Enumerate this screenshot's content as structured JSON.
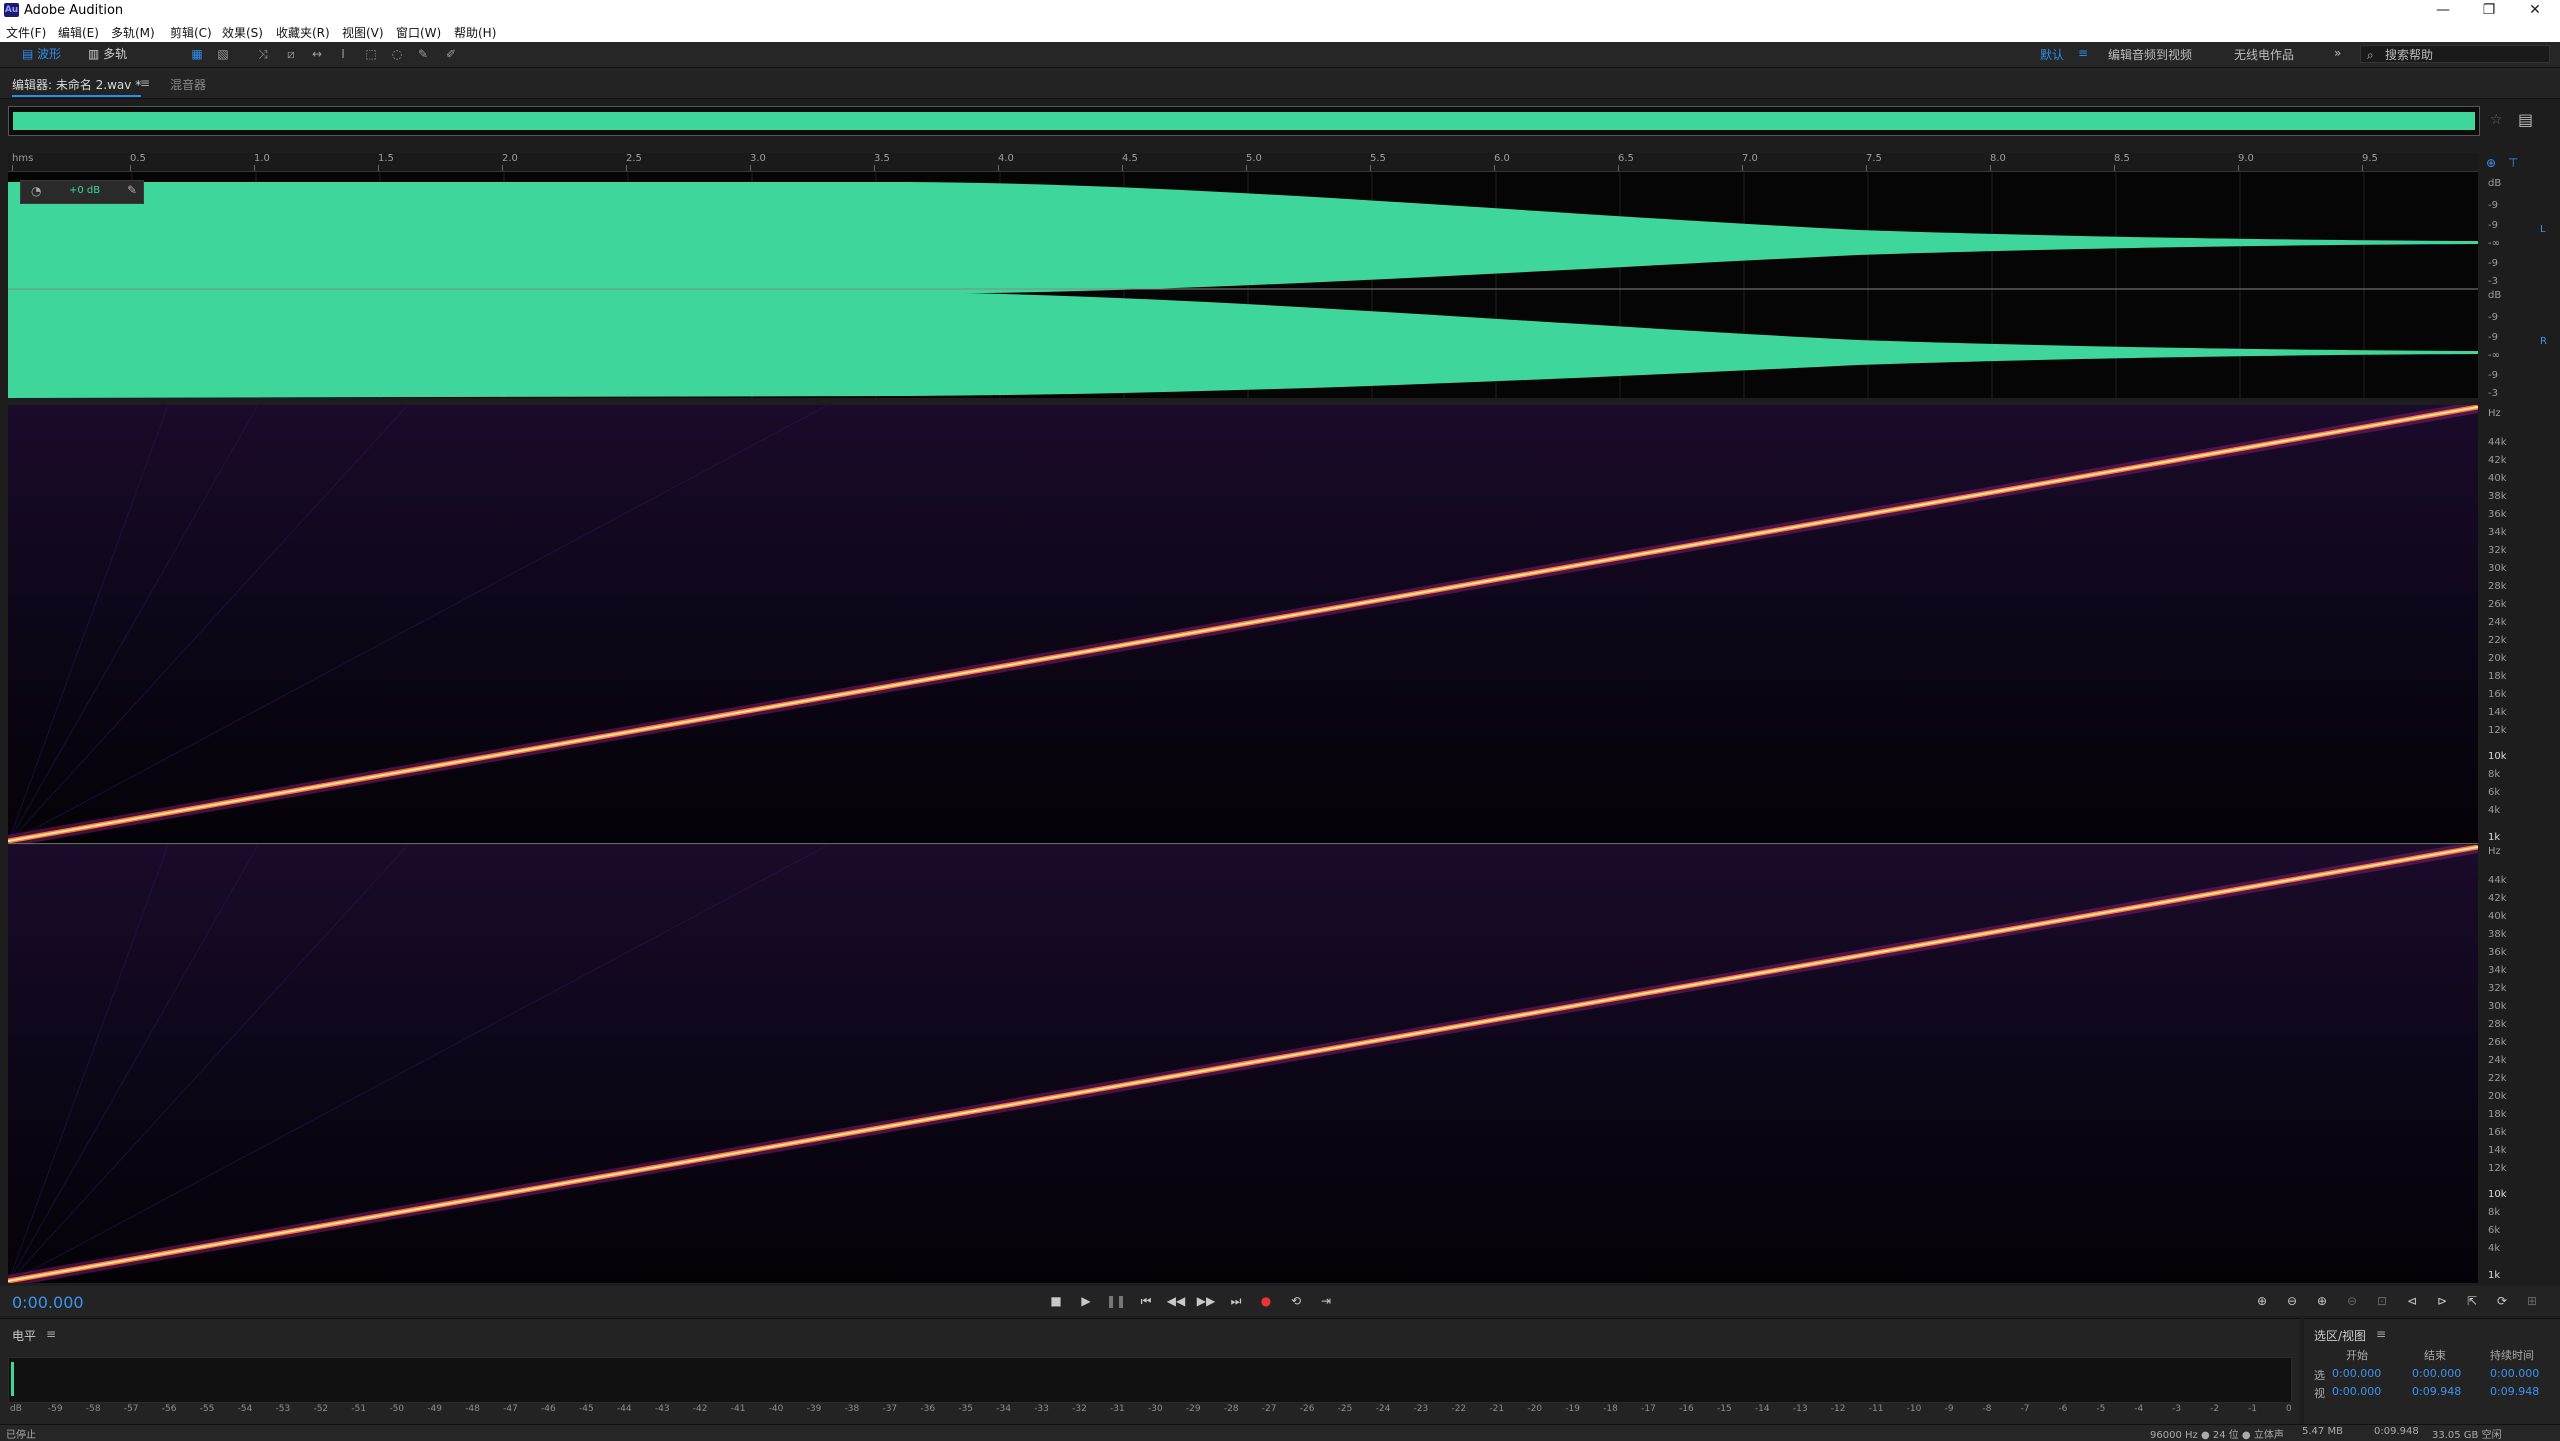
{
  "app": {
    "title": "Adobe Audition",
    "logo": "Au"
  },
  "window_controls": [
    "—",
    "❐",
    "✕"
  ],
  "menu": [
    "文件(F)",
    "编辑(E)",
    "多轨(M)",
    "剪辑(C)",
    "效果(S)",
    "收藏夹(R)",
    "视图(V)",
    "窗口(W)",
    "帮助(H)"
  ],
  "toolbar": {
    "waveform_label": "波形",
    "multitrack_label": "多轨",
    "workspace_active": "默认",
    "workspaces": [
      "编辑音频到视频",
      "无线电作品"
    ],
    "overflow": "»",
    "search_placeholder": "搜索帮助"
  },
  "tabs": {
    "editor": "编辑器: 未命名 2.wav *",
    "mixer": "混音器"
  },
  "ruler": {
    "unit": "hms",
    "ticks": [
      "0.5",
      "1.0",
      "1.5",
      "2.0",
      "2.5",
      "3.0",
      "3.5",
      "4.0",
      "4.5",
      "5.0",
      "5.5",
      "6.0",
      "6.5",
      "7.0",
      "7.5",
      "8.0",
      "8.5",
      "9.0",
      "9.5"
    ]
  },
  "hud": {
    "gain": "+0 dB"
  },
  "db_scale_top": [
    "dB",
    "-9",
    "-9",
    "-∞",
    "-9",
    "-3"
  ],
  "db_scale_bottom": [
    "dB",
    "-9",
    "-9",
    "-∞",
    "-9",
    "-3"
  ],
  "channels": {
    "left": "L",
    "right": "R"
  },
  "hz_scale": [
    "Hz",
    "44k",
    "42k",
    "40k",
    "38k",
    "36k",
    "34k",
    "32k",
    "30k",
    "28k",
    "26k",
    "24k",
    "22k",
    "20k",
    "18k",
    "16k",
    "14k",
    "12k",
    "10k",
    "8k",
    "6k",
    "4k",
    "1k"
  ],
  "transport": {
    "timecode": "0:00.000",
    "buttons": [
      "■",
      "▶",
      "❚❚",
      "⏮",
      "◀◀",
      "▶▶",
      "⏭",
      "●",
      "⟲",
      "⇥"
    ]
  },
  "levels": {
    "title": "电平",
    "meter_labels": [
      "dB",
      "-59",
      "-58",
      "-57",
      "-56",
      "-55",
      "-54",
      "-53",
      "-52",
      "-51",
      "-50",
      "-49",
      "-48",
      "-47",
      "-46",
      "-45",
      "-44",
      "-43",
      "-42",
      "-41",
      "-40",
      "-39",
      "-38",
      "-37",
      "-36",
      "-35",
      "-34",
      "-33",
      "-32",
      "-31",
      "-30",
      "-29",
      "-28",
      "-27",
      "-26",
      "-25",
      "-24",
      "-23",
      "-22",
      "-21",
      "-20",
      "-19",
      "-18",
      "-17",
      "-16",
      "-15",
      "-14",
      "-13",
      "-12",
      "-11",
      "-10",
      "-9",
      "-8",
      "-7",
      "-6",
      "-5",
      "-4",
      "-3",
      "-2",
      "-1",
      "0"
    ]
  },
  "selection": {
    "title": "选区/视图",
    "headers": [
      "开始",
      "结束",
      "持续时间"
    ],
    "rows": [
      {
        "label": "选",
        "start": "0:00.000",
        "end": "0:00.000",
        "duration": "0:00.000"
      },
      {
        "label": "视",
        "start": "0:00.000",
        "end": "0:09.948",
        "duration": "0:09.948"
      }
    ]
  },
  "status": {
    "left": "已停止",
    "sample_info": "96000 Hz ● 24 位 ● 立体声",
    "file_size": "5.47 MB",
    "duration": "0:09.948",
    "free_space": "33.05 GB 空闲"
  },
  "colors": {
    "accent": "#2d8ceb",
    "waveform": "#3fd69c",
    "spectrogram_bg": "#0a0410",
    "sweep": "#ffd07a"
  }
}
